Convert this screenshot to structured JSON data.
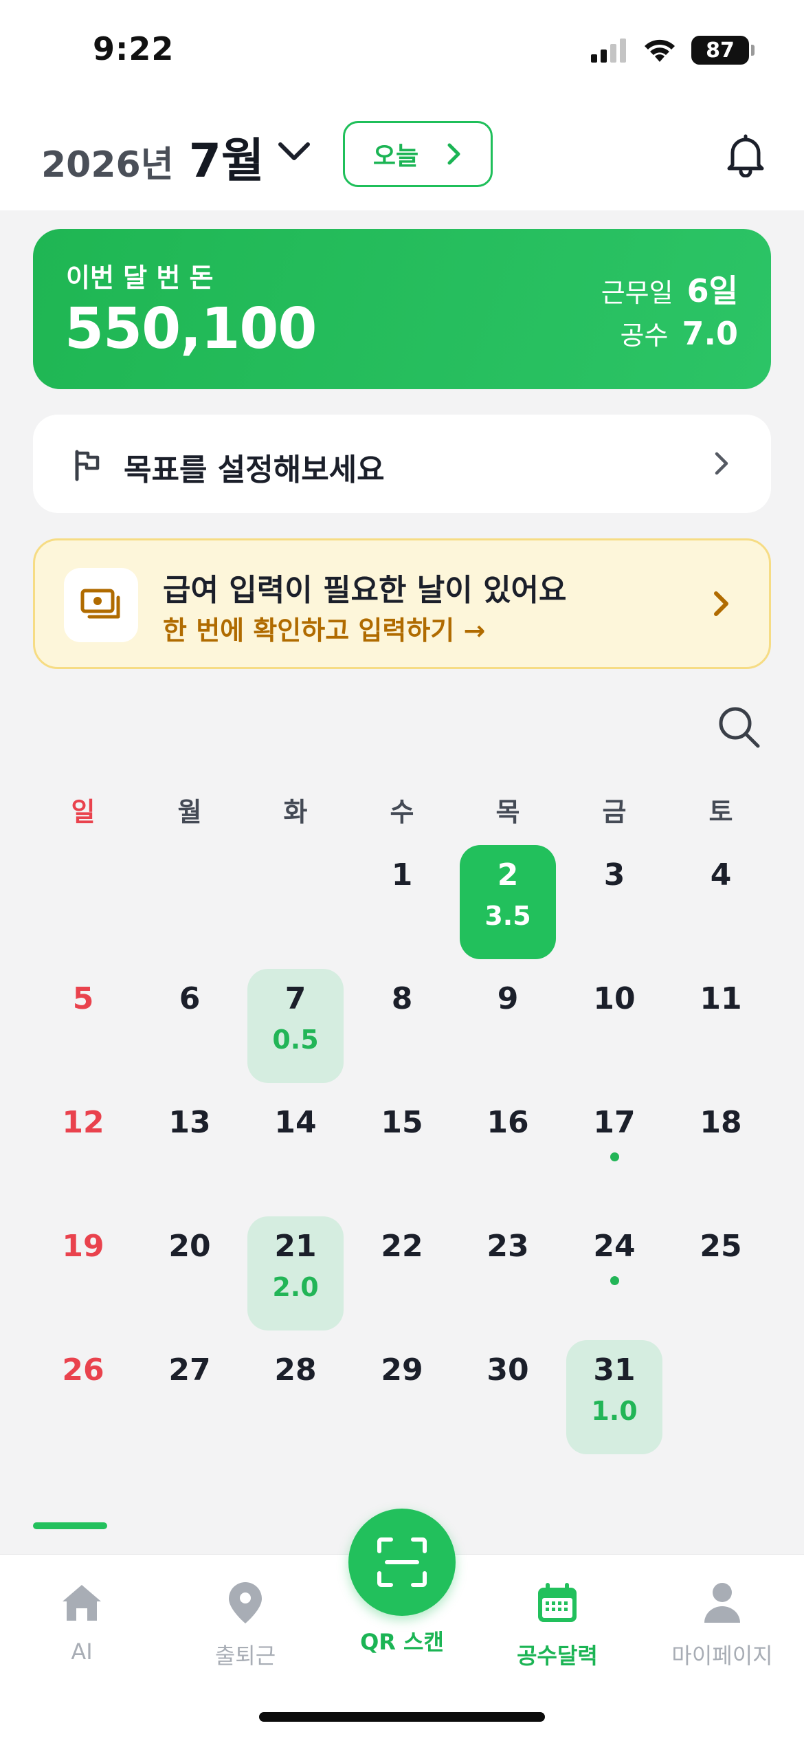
{
  "status_bar": {
    "time": "9:22",
    "battery": "87"
  },
  "header": {
    "year": "2026년",
    "month": "7월",
    "today_button": "오늘"
  },
  "earnings": {
    "label": "이번 달 번 돈",
    "amount": "550,100",
    "work_days_label": "근무일",
    "work_days_value": "6일",
    "gongsu_label": "공수",
    "gongsu_value": "7.0"
  },
  "goal": {
    "text": "목표를 설정해보세요"
  },
  "pay_banner": {
    "title": "급여 입력이 필요한 날이 있어요",
    "subtitle": "한 번에 확인하고 입력하기 →"
  },
  "calendar": {
    "weekdays": [
      "일",
      "월",
      "화",
      "수",
      "목",
      "금",
      "토"
    ],
    "days": [
      {
        "d": "1",
        "col": 3,
        "row": 0
      },
      {
        "d": "2",
        "col": 4,
        "row": 0,
        "sub": "3.5",
        "style": "active"
      },
      {
        "d": "3",
        "col": 5,
        "row": 0
      },
      {
        "d": "4",
        "col": 6,
        "row": 0
      },
      {
        "d": "5",
        "col": 0,
        "row": 1
      },
      {
        "d": "6",
        "col": 1,
        "row": 1
      },
      {
        "d": "7",
        "col": 2,
        "row": 1,
        "sub": "0.5",
        "style": "light"
      },
      {
        "d": "8",
        "col": 3,
        "row": 1
      },
      {
        "d": "9",
        "col": 4,
        "row": 1
      },
      {
        "d": "10",
        "col": 5,
        "row": 1
      },
      {
        "d": "11",
        "col": 6,
        "row": 1
      },
      {
        "d": "12",
        "col": 0,
        "row": 2
      },
      {
        "d": "13",
        "col": 1,
        "row": 2
      },
      {
        "d": "14",
        "col": 2,
        "row": 2
      },
      {
        "d": "15",
        "col": 3,
        "row": 2
      },
      {
        "d": "16",
        "col": 4,
        "row": 2
      },
      {
        "d": "17",
        "col": 5,
        "row": 2,
        "dot": true
      },
      {
        "d": "18",
        "col": 6,
        "row": 2
      },
      {
        "d": "19",
        "col": 0,
        "row": 3
      },
      {
        "d": "20",
        "col": 1,
        "row": 3
      },
      {
        "d": "21",
        "col": 2,
        "row": 3,
        "sub": "2.0",
        "style": "light"
      },
      {
        "d": "22",
        "col": 3,
        "row": 3
      },
      {
        "d": "23",
        "col": 4,
        "row": 3
      },
      {
        "d": "24",
        "col": 5,
        "row": 3,
        "dot": true
      },
      {
        "d": "25",
        "col": 6,
        "row": 3
      },
      {
        "d": "26",
        "col": 0,
        "row": 4
      },
      {
        "d": "27",
        "col": 1,
        "row": 4
      },
      {
        "d": "28",
        "col": 2,
        "row": 4
      },
      {
        "d": "29",
        "col": 3,
        "row": 4
      },
      {
        "d": "30",
        "col": 4,
        "row": 4
      },
      {
        "d": "31",
        "col": 5,
        "row": 4,
        "sub": "1.0",
        "style": "light"
      }
    ]
  },
  "nav": {
    "ai": "AI",
    "commute": "출퇴근",
    "qr": "QR 스캔",
    "calendar": "공수달력",
    "mypage": "마이페이지"
  },
  "colors": {
    "brand_green": "#22c05c",
    "sunday_red": "#e9424d",
    "banner_bg": "#fdf6da",
    "banner_accent": "#b06b00"
  }
}
